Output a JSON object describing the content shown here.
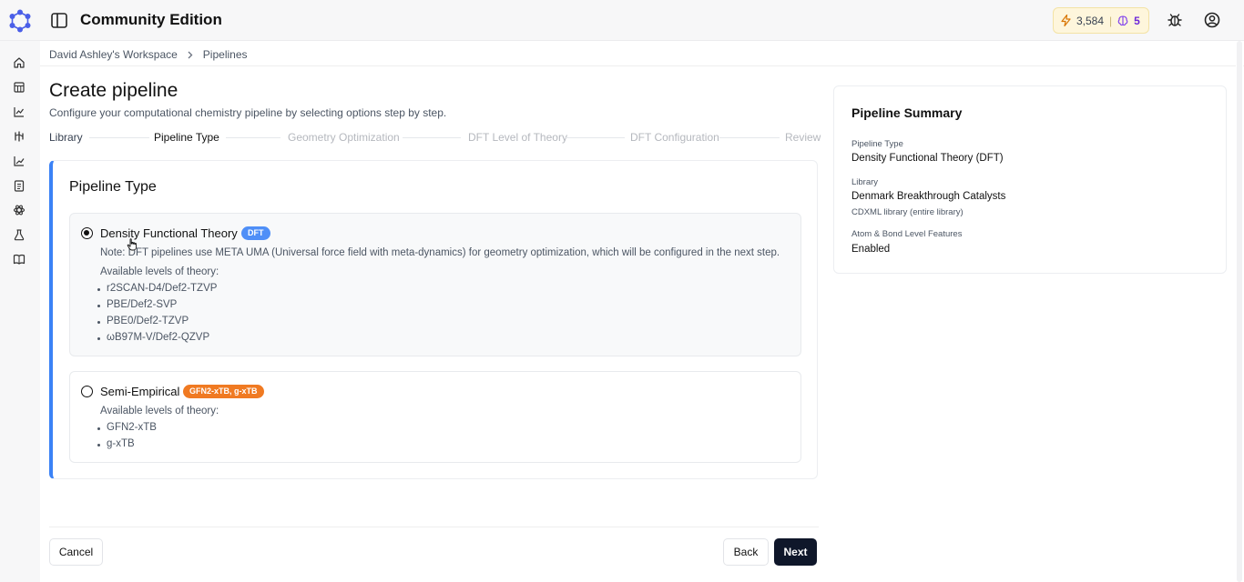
{
  "app": {
    "title": "Community Edition"
  },
  "header": {
    "credits_value": "3,584",
    "credits_separator": "|",
    "tokens_value": "5",
    "icons": [
      "logo-icon",
      "sidebar-toggle-icon",
      "bolt-icon",
      "brain-icon",
      "bug-icon",
      "account-icon"
    ]
  },
  "sidebar": {
    "items": [
      {
        "icon": "home-icon"
      },
      {
        "icon": "table-icon"
      },
      {
        "icon": "chart-icon"
      },
      {
        "icon": "pipeline-icon"
      },
      {
        "icon": "trend-icon"
      },
      {
        "icon": "clipboard-icon"
      },
      {
        "icon": "molecule-icon"
      },
      {
        "icon": "flask-icon"
      },
      {
        "icon": "book-icon"
      }
    ]
  },
  "breadcrumb": {
    "workspace": "David Ashley's Workspace",
    "current": "Pipelines"
  },
  "page": {
    "title": "Create pipeline",
    "subtitle": "Configure your computational chemistry pipeline by selecting options step by step."
  },
  "stepper": {
    "steps": [
      {
        "label": "Library",
        "state": "done"
      },
      {
        "label": "Pipeline Type",
        "state": "active"
      },
      {
        "label": "Geometry Optimization",
        "state": "todo"
      },
      {
        "label": "DFT Level of Theory",
        "state": "todo"
      },
      {
        "label": "DFT Configuration",
        "state": "todo"
      },
      {
        "label": "Review",
        "state": "todo"
      }
    ]
  },
  "pipeline_type": {
    "title": "Pipeline Type",
    "options": [
      {
        "title": "Density Functional Theory",
        "badge": "DFT",
        "selected": true,
        "note": "Note: DFT pipelines use META UMA (Universal force field with meta-dynamics) for geometry optimization, which will be configured in the next step.",
        "available_label": "Available levels of theory:",
        "levels": [
          "r2SCAN-D4/Def2-TZVP",
          "PBE/Def2-SVP",
          "PBE0/Def2-TZVP",
          "ωB97M-V/Def2-QZVP"
        ]
      },
      {
        "title": "Semi-Empirical",
        "badge": "GFN2-xTB, g-xTB",
        "selected": false,
        "available_label": "Available levels of theory:",
        "levels": [
          "GFN2-xTB",
          "g-xTB"
        ]
      }
    ]
  },
  "actions": {
    "cancel": "Cancel",
    "back": "Back",
    "next": "Next"
  },
  "summary": {
    "title": "Pipeline Summary",
    "pipeline_type_label": "Pipeline Type",
    "pipeline_type_value": "Density Functional Theory (DFT)",
    "library_label": "Library",
    "library_value": "Denmark Breakthrough Catalysts",
    "library_detail": "CDXML library (entire library)",
    "features_label": "Atom & Bond Level Features",
    "features_value": "Enabled"
  },
  "colors": {
    "accent_blue": "#3b82f6",
    "badge_blue": "#4f8ff7",
    "badge_orange": "#f07a22",
    "primary_button": "#0f172a",
    "credits_bg": "#fef6dc",
    "logo_blue": "#4a5ee8"
  }
}
